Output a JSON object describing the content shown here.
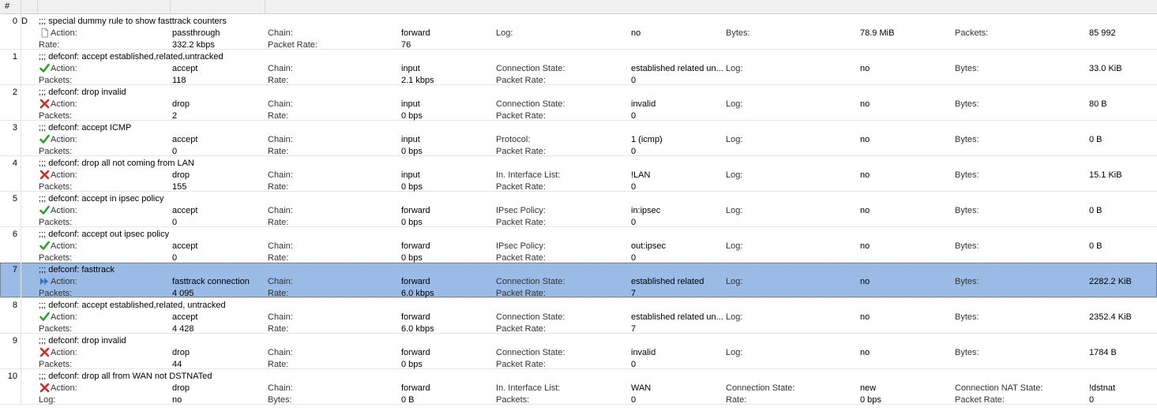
{
  "columns": {
    "num": "#"
  },
  "rows": [
    {
      "num": "0",
      "flag": "D",
      "comment": ";;; special dummy rule to show fasttrack counters",
      "icon": "page",
      "line1": [
        [
          "Action:",
          ""
        ],
        [
          "passthrough",
          ""
        ],
        [
          "Chain:",
          ""
        ],
        [
          "forward",
          ""
        ],
        [
          "Log:",
          ""
        ],
        [
          "no",
          ""
        ],
        [
          "Bytes:",
          ""
        ],
        [
          "78.9 MiB",
          ""
        ],
        [
          "Packets:",
          ""
        ],
        [
          "85 992",
          ""
        ]
      ],
      "line2": [
        [
          "Rate:",
          ""
        ],
        [
          "332.2 kbps",
          ""
        ],
        [
          "Packet Rate:",
          ""
        ],
        [
          "76",
          ""
        ]
      ]
    },
    {
      "num": "1",
      "flag": "",
      "comment": ";;; defconf: accept established,related,untracked",
      "icon": "check",
      "line1": [
        [
          "Action:",
          ""
        ],
        [
          "accept",
          ""
        ],
        [
          "Chain:",
          ""
        ],
        [
          "input",
          ""
        ],
        [
          "Connection State:",
          ""
        ],
        [
          "established related un...",
          ""
        ],
        [
          "Log:",
          ""
        ],
        [
          "no",
          ""
        ],
        [
          "Bytes:",
          ""
        ],
        [
          "33.0 KiB",
          ""
        ]
      ],
      "line2": [
        [
          "Packets:",
          ""
        ],
        [
          "118",
          ""
        ],
        [
          "Rate:",
          ""
        ],
        [
          "2.1 kbps",
          ""
        ],
        [
          "Packet Rate:",
          ""
        ],
        [
          "0",
          ""
        ]
      ]
    },
    {
      "num": "2",
      "flag": "",
      "comment": ";;; defconf: drop invalid",
      "icon": "x",
      "line1": [
        [
          "Action:",
          ""
        ],
        [
          "drop",
          ""
        ],
        [
          "Chain:",
          ""
        ],
        [
          "input",
          ""
        ],
        [
          "Connection State:",
          ""
        ],
        [
          "invalid",
          ""
        ],
        [
          "Log:",
          ""
        ],
        [
          "no",
          ""
        ],
        [
          "Bytes:",
          ""
        ],
        [
          "80 B",
          ""
        ]
      ],
      "line2": [
        [
          "Packets:",
          ""
        ],
        [
          "2",
          ""
        ],
        [
          "Rate:",
          ""
        ],
        [
          "0 bps",
          ""
        ],
        [
          "Packet Rate:",
          ""
        ],
        [
          "0",
          ""
        ]
      ]
    },
    {
      "num": "3",
      "flag": "",
      "comment": ";;; defconf: accept ICMP",
      "icon": "check",
      "line1": [
        [
          "Action:",
          ""
        ],
        [
          "accept",
          ""
        ],
        [
          "Chain:",
          ""
        ],
        [
          "input",
          ""
        ],
        [
          "Protocol:",
          ""
        ],
        [
          "1 (icmp)",
          ""
        ],
        [
          "Log:",
          ""
        ],
        [
          "no",
          ""
        ],
        [
          "Bytes:",
          ""
        ],
        [
          "0 B",
          ""
        ]
      ],
      "line2": [
        [
          "Packets:",
          ""
        ],
        [
          "0",
          ""
        ],
        [
          "Rate:",
          ""
        ],
        [
          "0 bps",
          ""
        ],
        [
          "Packet Rate:",
          ""
        ],
        [
          "0",
          ""
        ]
      ]
    },
    {
      "num": "4",
      "flag": "",
      "comment": ";;; defconf: drop all not coming from LAN",
      "icon": "x",
      "line1": [
        [
          "Action:",
          ""
        ],
        [
          "drop",
          ""
        ],
        [
          "Chain:",
          ""
        ],
        [
          "input",
          ""
        ],
        [
          "In. Interface List:",
          ""
        ],
        [
          "!LAN",
          ""
        ],
        [
          "Log:",
          ""
        ],
        [
          "no",
          ""
        ],
        [
          "Bytes:",
          ""
        ],
        [
          "15.1 KiB",
          ""
        ]
      ],
      "line2": [
        [
          "Packets:",
          ""
        ],
        [
          "155",
          ""
        ],
        [
          "Rate:",
          ""
        ],
        [
          "0 bps",
          ""
        ],
        [
          "Packet Rate:",
          ""
        ],
        [
          "0",
          ""
        ]
      ]
    },
    {
      "num": "5",
      "flag": "",
      "comment": ";;; defconf: accept in ipsec policy",
      "icon": "check",
      "line1": [
        [
          "Action:",
          ""
        ],
        [
          "accept",
          ""
        ],
        [
          "Chain:",
          ""
        ],
        [
          "forward",
          ""
        ],
        [
          "IPsec Policy:",
          ""
        ],
        [
          "in:ipsec",
          ""
        ],
        [
          "Log:",
          ""
        ],
        [
          "no",
          ""
        ],
        [
          "Bytes:",
          ""
        ],
        [
          "0 B",
          ""
        ]
      ],
      "line2": [
        [
          "Packets:",
          ""
        ],
        [
          "0",
          ""
        ],
        [
          "Rate:",
          ""
        ],
        [
          "0 bps",
          ""
        ],
        [
          "Packet Rate:",
          ""
        ],
        [
          "0",
          ""
        ]
      ]
    },
    {
      "num": "6",
      "flag": "",
      "comment": ";;; defconf: accept out ipsec policy",
      "icon": "check",
      "line1": [
        [
          "Action:",
          ""
        ],
        [
          "accept",
          ""
        ],
        [
          "Chain:",
          ""
        ],
        [
          "forward",
          ""
        ],
        [
          "IPsec Policy:",
          ""
        ],
        [
          "out:ipsec",
          ""
        ],
        [
          "Log:",
          ""
        ],
        [
          "no",
          ""
        ],
        [
          "Bytes:",
          ""
        ],
        [
          "0 B",
          ""
        ]
      ],
      "line2": [
        [
          "Packets:",
          ""
        ],
        [
          "0",
          ""
        ],
        [
          "Rate:",
          ""
        ],
        [
          "0 bps",
          ""
        ],
        [
          "Packet Rate:",
          ""
        ],
        [
          "0",
          ""
        ]
      ]
    },
    {
      "num": "7",
      "flag": "",
      "comment": ";;; defconf: fasttrack",
      "icon": "fast",
      "selected": true,
      "line1": [
        [
          "Action:",
          ""
        ],
        [
          "fasttrack connection",
          ""
        ],
        [
          "Chain:",
          ""
        ],
        [
          "forward",
          ""
        ],
        [
          "Connection State:",
          ""
        ],
        [
          "established related",
          ""
        ],
        [
          "Log:",
          ""
        ],
        [
          "no",
          ""
        ],
        [
          "Bytes:",
          ""
        ],
        [
          "2282.2 KiB",
          ""
        ]
      ],
      "line2": [
        [
          "Packets:",
          ""
        ],
        [
          "4 095",
          ""
        ],
        [
          "Rate:",
          ""
        ],
        [
          "6.0 kbps",
          ""
        ],
        [
          "Packet Rate:",
          ""
        ],
        [
          "7",
          ""
        ]
      ]
    },
    {
      "num": "8",
      "flag": "",
      "comment": ";;; defconf: accept established,related, untracked",
      "icon": "check",
      "line1": [
        [
          "Action:",
          ""
        ],
        [
          "accept",
          ""
        ],
        [
          "Chain:",
          ""
        ],
        [
          "forward",
          ""
        ],
        [
          "Connection State:",
          ""
        ],
        [
          "established related un...",
          ""
        ],
        [
          "Log:",
          ""
        ],
        [
          "no",
          ""
        ],
        [
          "Bytes:",
          ""
        ],
        [
          "2352.4 KiB",
          ""
        ]
      ],
      "line2": [
        [
          "Packets:",
          ""
        ],
        [
          "4 428",
          ""
        ],
        [
          "Rate:",
          ""
        ],
        [
          "6.0 kbps",
          ""
        ],
        [
          "Packet Rate:",
          ""
        ],
        [
          "7",
          ""
        ]
      ]
    },
    {
      "num": "9",
      "flag": "",
      "comment": ";;; defconf: drop invalid",
      "icon": "x",
      "line1": [
        [
          "Action:",
          ""
        ],
        [
          "drop",
          ""
        ],
        [
          "Chain:",
          ""
        ],
        [
          "forward",
          ""
        ],
        [
          "Connection State:",
          ""
        ],
        [
          "invalid",
          ""
        ],
        [
          "Log:",
          ""
        ],
        [
          "no",
          ""
        ],
        [
          "Bytes:",
          ""
        ],
        [
          "1784 B",
          ""
        ]
      ],
      "line2": [
        [
          "Packets:",
          ""
        ],
        [
          "44",
          ""
        ],
        [
          "Rate:",
          ""
        ],
        [
          "0 bps",
          ""
        ],
        [
          "Packet Rate:",
          ""
        ],
        [
          "0",
          ""
        ]
      ]
    },
    {
      "num": "10",
      "flag": "",
      "comment": ";;; defconf:  drop all from WAN not DSTNATed",
      "icon": "x",
      "line1": [
        [
          "Action:",
          ""
        ],
        [
          "drop",
          ""
        ],
        [
          "Chain:",
          ""
        ],
        [
          "forward",
          ""
        ],
        [
          "In. Interface List:",
          ""
        ],
        [
          "WAN",
          ""
        ],
        [
          "Connection State:",
          ""
        ],
        [
          "new",
          ""
        ],
        [
          "Connection NAT State:",
          ""
        ],
        [
          "!dstnat",
          ""
        ]
      ],
      "line2": [
        [
          "Log:",
          ""
        ],
        [
          "no",
          ""
        ],
        [
          "Bytes:",
          ""
        ],
        [
          "0 B",
          ""
        ],
        [
          "Packets:",
          ""
        ],
        [
          "0",
          ""
        ],
        [
          "Rate:",
          ""
        ],
        [
          "0 bps",
          ""
        ],
        [
          "Packet Rate:",
          ""
        ],
        [
          "0",
          ""
        ]
      ]
    }
  ],
  "colors": {
    "selection": "#99bbe6",
    "check": "#2aa12a",
    "x": "#d12a2a",
    "fast": "#2f73c9",
    "page": "#9a9a9a"
  }
}
